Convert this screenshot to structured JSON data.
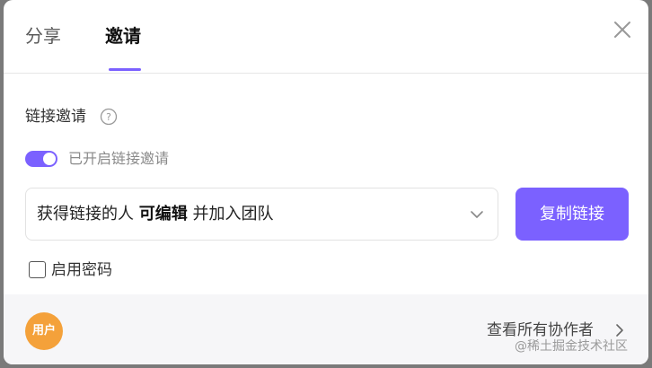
{
  "tabs": [
    {
      "label": "分享",
      "active": false
    },
    {
      "label": "邀请",
      "active": true
    }
  ],
  "accent_color": "#7b61ff",
  "section_title": "链接邀请",
  "help_icon": "question-circle-icon",
  "link_invite": {
    "enabled": true,
    "label": "已开启链接邀请"
  },
  "permission_select": {
    "prefix": "获得链接的人 ",
    "permission": "可编辑",
    "suffix": " 并加入团队"
  },
  "copy_button_label": "复制链接",
  "password": {
    "checked": false,
    "label": "启用密码"
  },
  "footer": {
    "avatar_text": "用户",
    "avatar_color": "#f4a13a",
    "view_all_label": "查看所有协作者"
  },
  "watermark": "@稀土掘金技术社区"
}
